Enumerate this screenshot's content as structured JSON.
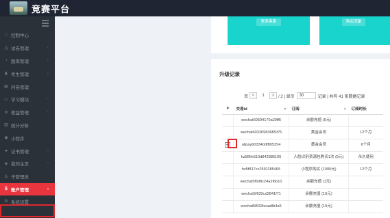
{
  "app": {
    "title": "竞赛平台"
  },
  "sidebar": {
    "items": [
      {
        "icon": "⌂",
        "label": "控制中心",
        "chevron": false
      },
      {
        "icon": "◷",
        "label": "试卷管理",
        "chevron": true
      },
      {
        "icon": "◔",
        "label": "题库管理",
        "chevron": true
      },
      {
        "icon": "♟",
        "label": "考生管理",
        "chevron": true
      },
      {
        "icon": "▤",
        "label": "问卷管理",
        "chevron": false
      },
      {
        "icon": "▭",
        "label": "学习模块",
        "chevron": true
      },
      {
        "icon": "✉",
        "label": "收益管理",
        "chevron": true
      },
      {
        "icon": "▥",
        "label": "统计分析",
        "chevron": false
      },
      {
        "icon": "◉",
        "label": "小程序",
        "chevron": false
      },
      {
        "icon": "●",
        "label": "证书管理",
        "chevron": true
      },
      {
        "icon": "◈",
        "label": "我的主页",
        "chevron": true
      },
      {
        "icon": "♙",
        "label": "子管理员",
        "chevron": false
      },
      {
        "icon": "$",
        "label": "账户管理",
        "chevron": true,
        "active": true
      },
      {
        "icon": "⚙",
        "label": "系统设置",
        "chevron": false
      }
    ]
  },
  "tiles": {
    "left_button": "联系客服",
    "right_button": "购买流量"
  },
  "records": {
    "title": "升级记录",
    "pager": {
      "page_label": "页",
      "page": "1",
      "total_pages_text": "/ 2 | 显示",
      "per_page": "30",
      "summary": "记录 | 共有 41 条数据记录"
    },
    "columns": [
      "#",
      "交易id",
      "订阅",
      "订阅时长"
    ],
    "rows": [
      {
        "checked": false,
        "id": "wechat60594170a29ff6",
        "sub": "余额充值 (5元)",
        "dur": ""
      },
      {
        "checked": false,
        "id": "wechat6033698368Sf75",
        "sub": "黄金会员",
        "dur": "12个月"
      },
      {
        "checked": true,
        "id": "alipay603340df805254",
        "sub": "黄金会员",
        "dur": "6个月"
      },
      {
        "checked": false,
        "id": "hz5f9fe510d842885105",
        "sub": "人脸识别资源包购买1次 (5元)",
        "dur": "永久使用"
      },
      {
        "checked": false,
        "id": "hz5f817cc2591185465",
        "sub": "小程序购买 (1000元)",
        "dur": "12个月"
      },
      {
        "checked": false,
        "id": "wechat5f698c24a2f6b10",
        "sub": "余额充值 (1元)",
        "dur": ""
      },
      {
        "checked": false,
        "id": "wechat5f632cd2841f71",
        "sub": "余额充值 (10元)",
        "dur": ""
      },
      {
        "checked": false,
        "id": "wechat5f632bcaa8b4a5",
        "sub": "余额充值 (10元)",
        "dur": ""
      }
    ]
  },
  "colors": {
    "accent": "#e9353d",
    "sidebar": "#2b3138",
    "topbar": "#1f2532",
    "tile": "#19d4cd"
  }
}
